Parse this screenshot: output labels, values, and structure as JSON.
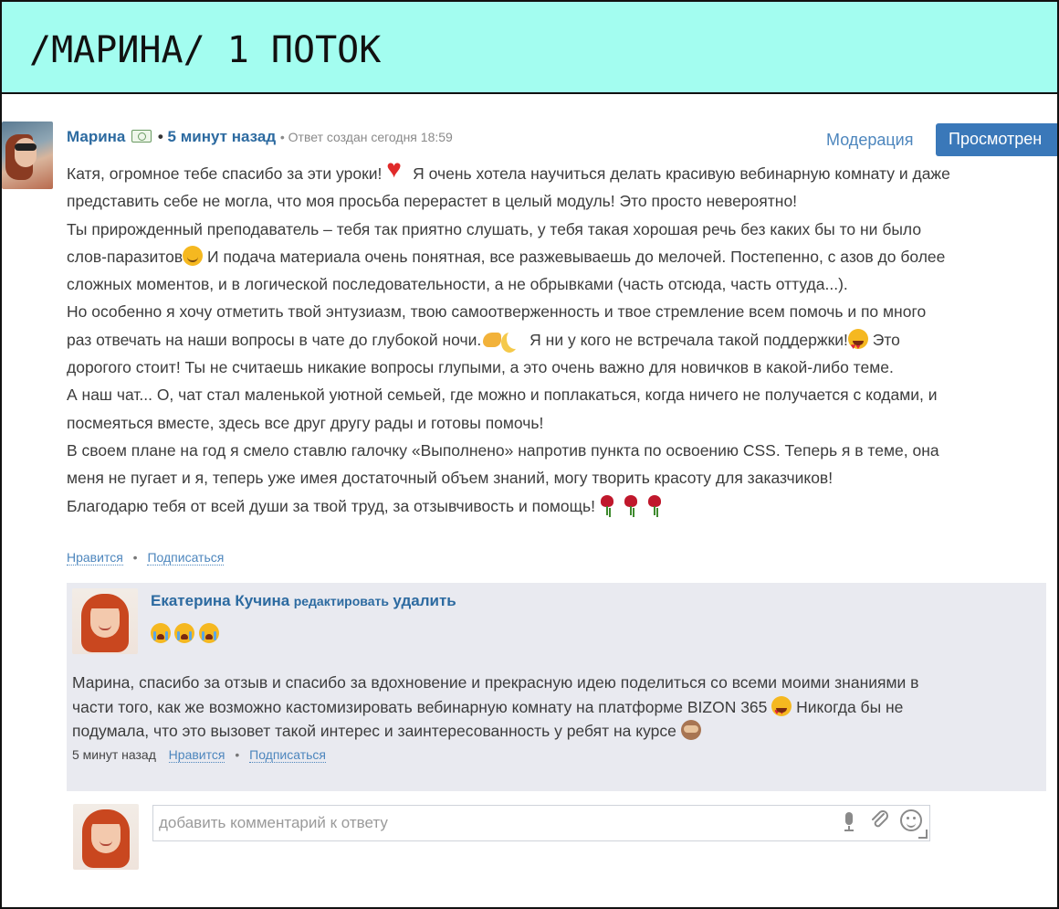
{
  "banner": {
    "title": "/МАРИНА/ 1 ПОТОК",
    "background": "#a3fdf0"
  },
  "review": {
    "author": "Марина",
    "badge_icon": "money-badge-icon",
    "separator": "•",
    "time": "5 минут назад",
    "meta": "• Ответ создан сегодня 18:59",
    "moderation_label": "Модерация",
    "viewed_label": "Просмотрен",
    "lines": [
      "Катя, огромное тебе спасибо за эти уроки!",
      "Я очень хотела научиться делать красивую вебинарную комнату и даже",
      "представить себе не могла, что моя просьба перерастет в целый модуль! Это просто невероятно!",
      "Ты прирожденный преподаватель – тебя так приятно слушать, у тебя такая хорошая речь без каких бы то ни было",
      "слов-паразитов",
      "И подача материала очень понятная, все разжевываешь до мелочей. Постепенно, с азов до более",
      "сложных моментов, и в логической последовательности, а не обрывками (часть отсюда, часть оттуда...).",
      "Но особенно я хочу отметить твой энтузиазм, твою самоотверженность и твое стремление всем помочь и по много",
      "раз отвечать на наши вопросы в чате до глубокой ночи.",
      "Я ни у кого не встречала такой поддержки!",
      "Это",
      "дорогого стоит! Ты не считаешь никакие вопросы глупыми, а это очень важно для новичков в какой-либо теме.",
      "А наш чат... О, чат стал маленькой уютной семьей, где можно и поплакаться, когда ничего не получается с кодами, и",
      "посмеяться вместе, здесь все друг другу рады и готовы помочь!",
      "В своем плане на год я смело ставлю галочку «Выполнено» напротив пункта по освоению CSS. Теперь я в теме, она",
      "меня не пугает и я, теперь уже имея достаточный объем знаний, могу творить красоту для заказчиков!",
      "Благодарю тебя от всей души за твой труд, за отзывчивость и помощь!"
    ],
    "like_label": "Нравится",
    "subscribe_label": "Подписаться",
    "dot": "•"
  },
  "reply": {
    "author": "Екатерина Кучина",
    "edit_label": "редактировать",
    "delete_label": "удалить",
    "lines": [
      "Марина, спасибо за отзыв и спасибо за вдохновение и прекрасную идею поделиться со всеми моими знаниями в",
      "части того, как же возможно кастомизировать вебинарную комнату на платформе BIZON 365",
      "Никогда бы не",
      "подумала, что это вызовет такой интерес и заинтересованность у ребят на курсе"
    ],
    "time": "5 минут назад",
    "like_label": "Нравится",
    "subscribe_label": "Подписаться",
    "dot": "•",
    "background": "#e9eaf0"
  },
  "comment": {
    "placeholder": "добавить комментарий к ответу"
  },
  "colors": {
    "link": "#2c6aa0",
    "button": "#3a78b9"
  }
}
